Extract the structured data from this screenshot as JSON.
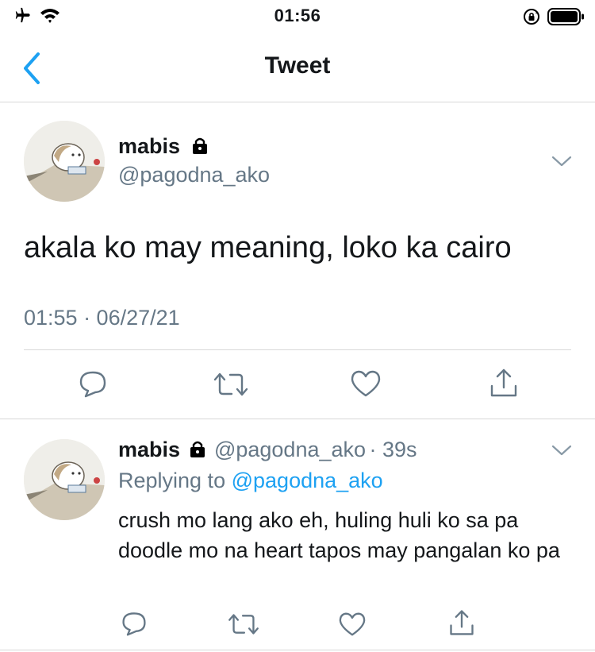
{
  "status_bar": {
    "time": "01:56",
    "icons": [
      "airplane-icon",
      "wifi-icon",
      "rotation-lock-icon",
      "battery-icon"
    ]
  },
  "nav": {
    "title": "Tweet",
    "back_icon": "chevron-left-icon"
  },
  "main_tweet": {
    "name": "mabis",
    "handle": "@pagodna_ako",
    "protected_icon": "lock-icon",
    "text": "akala ko may meaning, loko ka cairo",
    "timestamp": "01:55 · 06/27/21",
    "actions": [
      "reply-icon",
      "retweet-icon",
      "like-icon",
      "share-icon"
    ]
  },
  "reply_tweet": {
    "name": "mabis",
    "handle": "@pagodna_ako",
    "time_ago": "· 39s",
    "replying_prefix": "Replying to",
    "replying_to": "@pagodna_ako",
    "text": "crush mo lang ako eh, huling huli ko sa pa doodle mo na heart tapos may pangalan ko pa",
    "actions": [
      "reply-icon",
      "retweet-icon",
      "like-icon",
      "share-icon"
    ]
  },
  "colors": {
    "accent": "#1da1f2",
    "text": "#14171a",
    "secondary": "#657786",
    "divider": "#d8d8d8"
  }
}
